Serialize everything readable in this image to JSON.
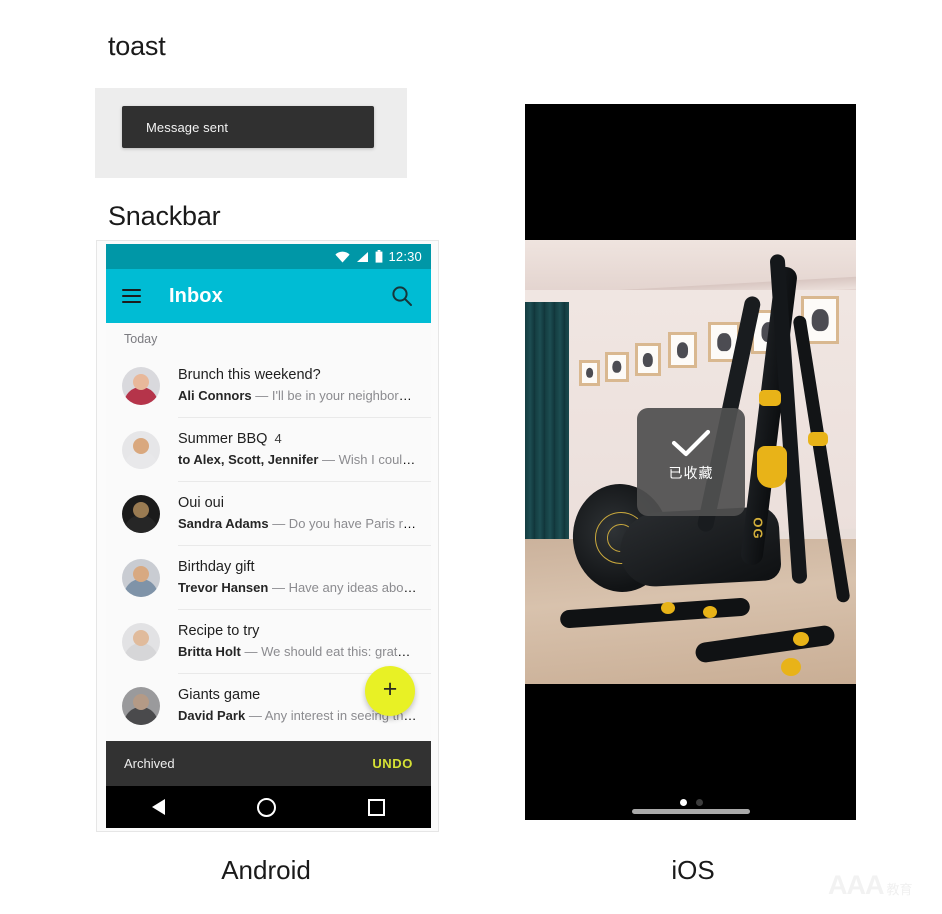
{
  "sections": {
    "toast_heading": "toast",
    "snackbar_heading": "Snackbar"
  },
  "toast_demo": {
    "message": "Message sent",
    "background": "#ededed",
    "toast_color": "#303030",
    "text_color": "#f2f2f2"
  },
  "android": {
    "caption": "Android",
    "status_bar": {
      "time": "12:30",
      "background": "#0097a7",
      "icons": [
        "wifi-icon",
        "signal-icon",
        "battery-icon"
      ]
    },
    "app_bar": {
      "title": "Inbox",
      "background": "#00bcd4",
      "menu_icon": "hamburger-menu-icon",
      "search_icon": "search-icon"
    },
    "list_header": "Today",
    "emails": [
      {
        "subject": "Brunch this weekend?",
        "count": "",
        "sender": "Ali Connors",
        "snippet": "— I'll be in your neighborhood...",
        "avatar_face": "#e8b89a",
        "avatar_body": "#b5344a"
      },
      {
        "subject": "Summer BBQ",
        "count": "4",
        "sender": "to Alex, Scott, Jennifer",
        "snippet": "— Wish I could …",
        "avatar_face": "#d9a87e",
        "avatar_body": "#e8e8ea"
      },
      {
        "subject": "Oui oui",
        "count": "",
        "sender": "Sandra Adams",
        "snippet": "— Do you have Paris reco...",
        "avatar_face": "#9a7b52",
        "avatar_body": "#1b1b1b"
      },
      {
        "subject": "Birthday gift",
        "count": "",
        "sender": "Trevor Hansen",
        "snippet": "— Have any ideas about …",
        "avatar_face": "#d8a981",
        "avatar_body": "#7f93a8"
      },
      {
        "subject": "Recipe to try",
        "count": "",
        "sender": "Britta Holt",
        "snippet": "— We should eat this: grated …",
        "avatar_face": "#e0bb9c",
        "avatar_body": "#d6d6d8"
      },
      {
        "subject": "Giants game",
        "count": "",
        "sender": "David Park",
        "snippet": "— Any interest in seeing the G…",
        "avatar_face": "#b49a86",
        "avatar_body": "#4a4a4c"
      }
    ],
    "fab": {
      "icon": "plus-icon",
      "label": "+",
      "color": "#e8f125"
    },
    "snackbar": {
      "message": "Archived",
      "action": "UNDO",
      "background": "#323232",
      "action_color": "#d6e135"
    },
    "nav_bar": {
      "back": "back-triangle-icon",
      "home": "home-circle-icon",
      "recents": "recents-square-icon"
    }
  },
  "ios": {
    "caption": "iOS",
    "toast": {
      "icon": "checkmark-icon",
      "label": "已收藏",
      "background": "rgba(80,80,80,0.93)"
    },
    "page_dots": {
      "total": 2,
      "active_index": 0
    },
    "home_indicator": "home-indicator-bar"
  },
  "watermark": {
    "logo": "AAA",
    "text": "教育"
  }
}
